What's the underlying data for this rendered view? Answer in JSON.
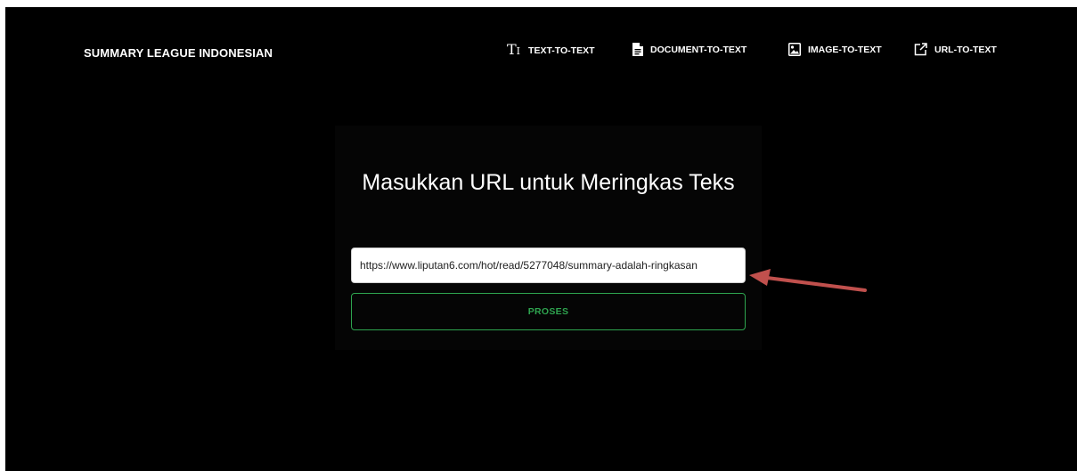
{
  "nav": {
    "brand": "SUMMARY LEAGUE INDONESIAN",
    "links": [
      {
        "label": "TEXT-TO-TEXT",
        "icon": "text-size-icon"
      },
      {
        "label": "DOCUMENT-TO-TEXT",
        "icon": "document-icon"
      },
      {
        "label": "IMAGE-TO-TEXT",
        "icon": "image-icon"
      },
      {
        "label": "URL-TO-TEXT",
        "icon": "external-link-icon"
      }
    ]
  },
  "main": {
    "title": "Masukkan URL untuk Meringkas Teks",
    "url_value": "https://www.liputan6.com/hot/read/5277048/summary-adalah-ringkasan",
    "submit_label": "PROSES"
  },
  "colors": {
    "background": "#000000",
    "accent": "#2ea44f",
    "annotation_arrow": "#c0504d"
  }
}
